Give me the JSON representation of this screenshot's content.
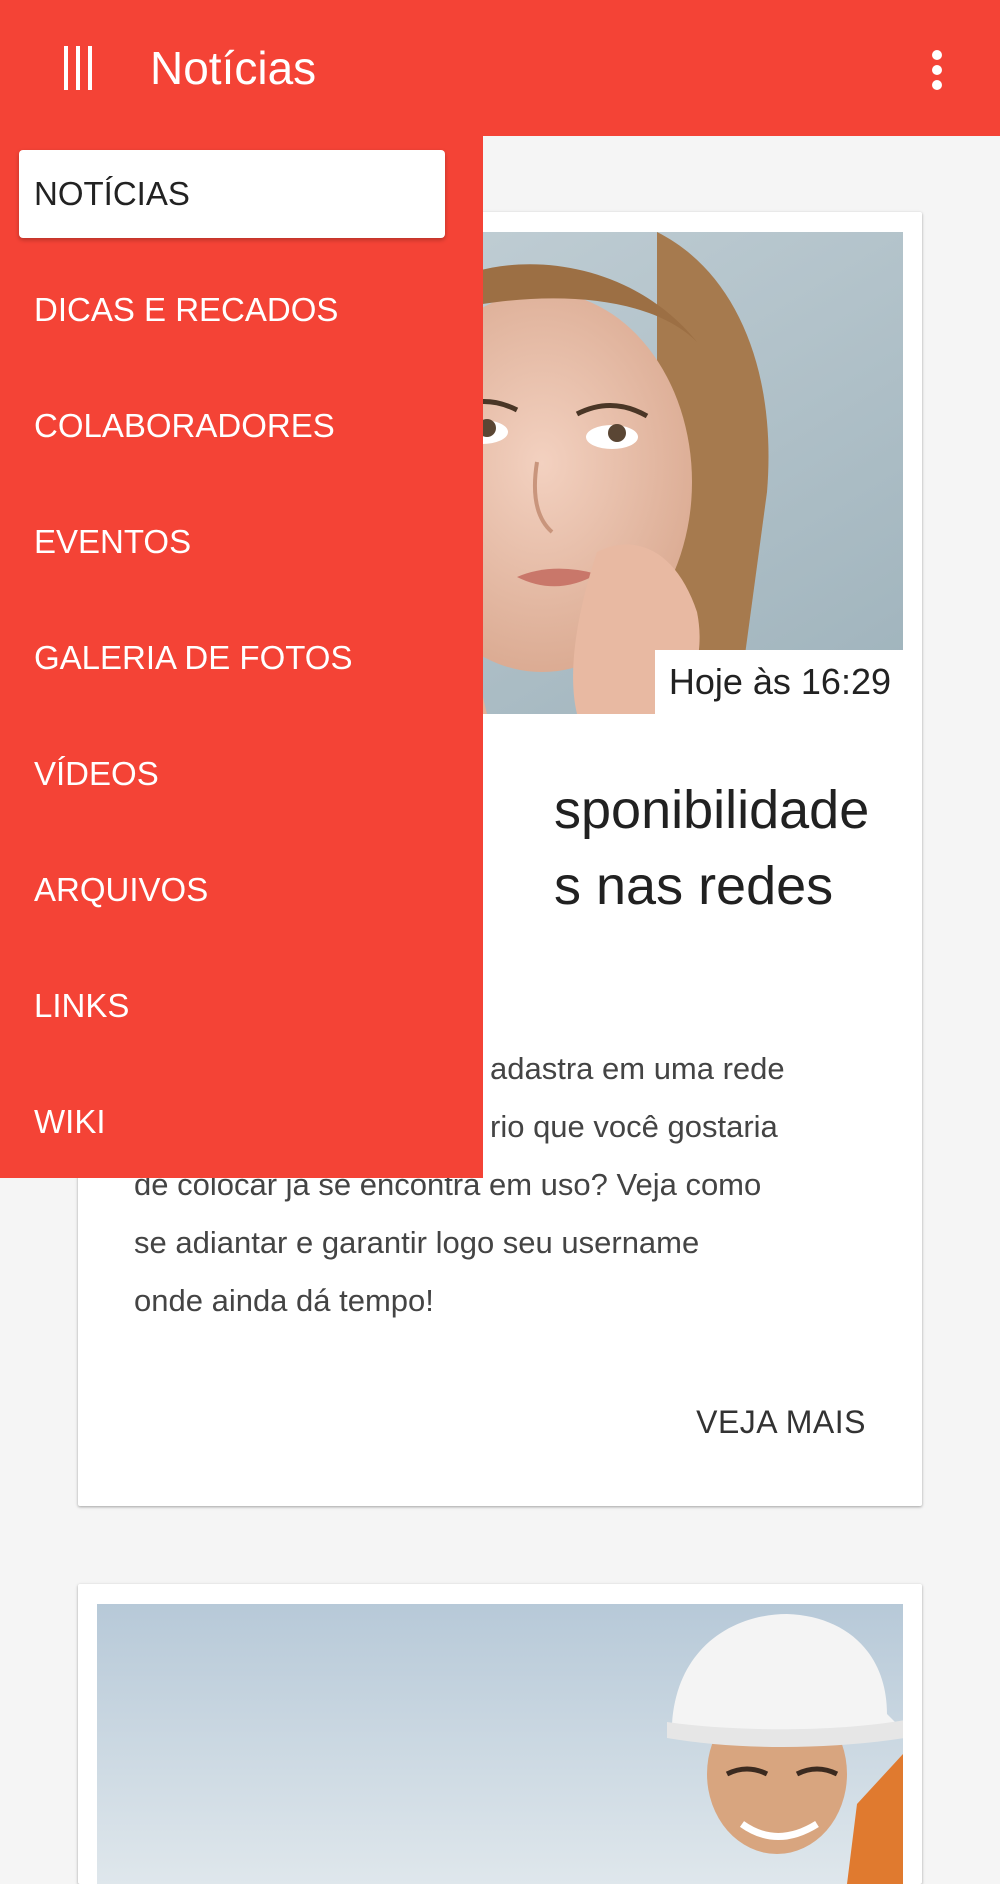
{
  "app_bar": {
    "title": "Notícias",
    "menu_icon": "menu-icon",
    "overflow_icon": "more-vert-icon",
    "color": "#f44336"
  },
  "drawer": {
    "items": [
      {
        "label": "NOTÍCIAS",
        "active": true
      },
      {
        "label": "DICAS E RECADOS"
      },
      {
        "label": "COLABORADORES"
      },
      {
        "label": "EVENTOS"
      },
      {
        "label": "GALERIA DE FOTOS"
      },
      {
        "label": "VÍDEOS"
      },
      {
        "label": "ARQUIVOS"
      },
      {
        "label": "LINKS"
      },
      {
        "label": "WIKI"
      }
    ]
  },
  "feed": {
    "cards": [
      {
        "timestamp": "Hoje às 16:29",
        "title": "sponibilidade\ns nas redes",
        "body": "adastra em uma rede\nrio que você gostaria\nde colocar já se encontra em uso? Veja como\nse adiantar e garantir logo seu username\nonde ainda dá tempo!",
        "action": "VEJA MAIS"
      }
    ]
  }
}
